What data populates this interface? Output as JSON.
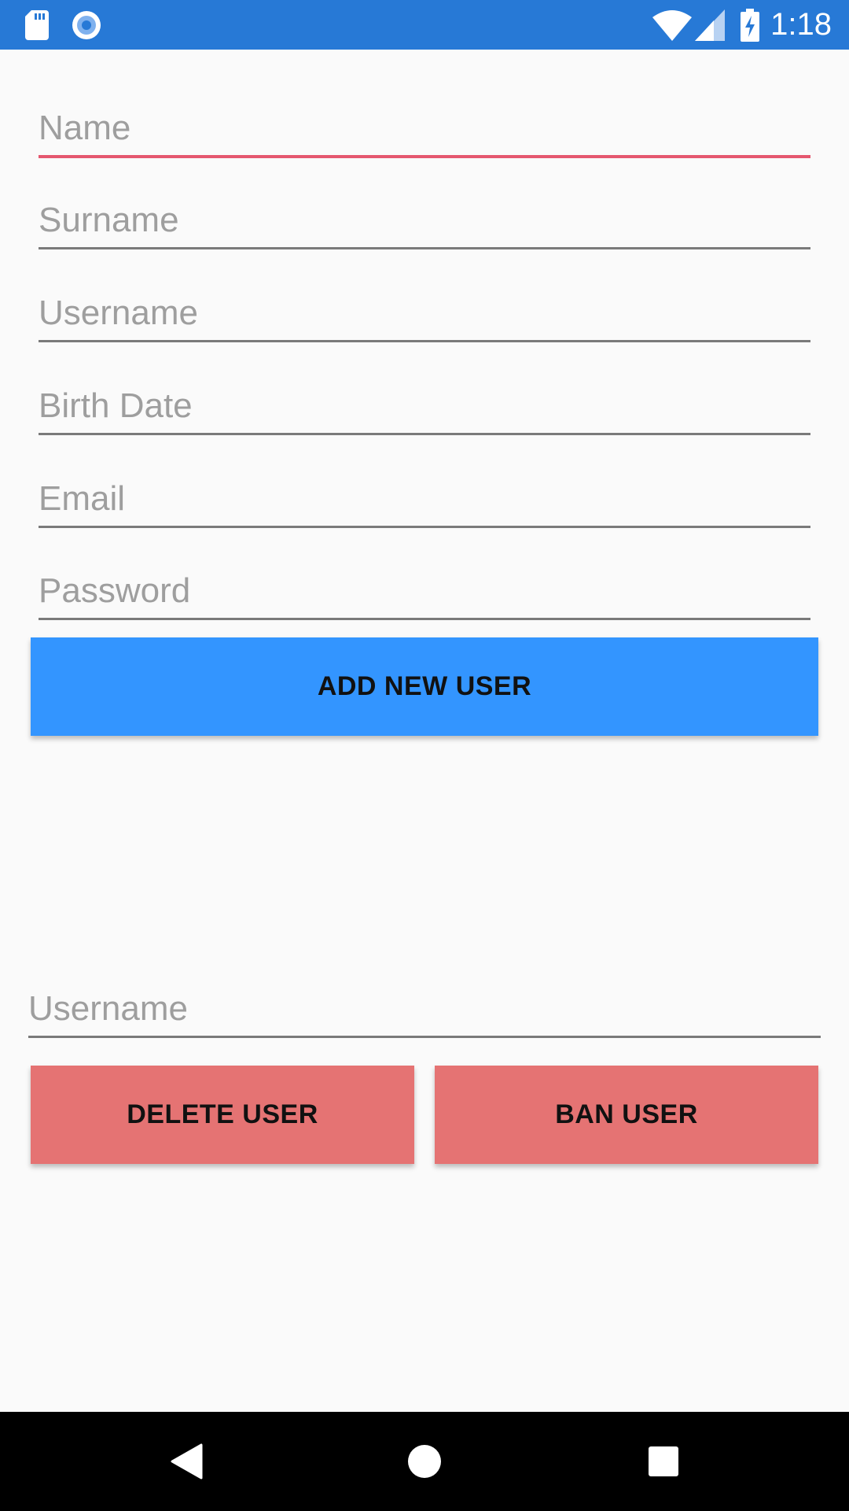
{
  "status_bar": {
    "time": "1:18",
    "icons_left": [
      "sd-card-icon",
      "record-icon"
    ],
    "icons_right": [
      "wifi-icon",
      "signal-icon",
      "battery-charging-icon"
    ],
    "color": "#2779d6"
  },
  "form": {
    "name_placeholder": "Name",
    "surname_placeholder": "Surname",
    "username_placeholder": "Username",
    "birth_date_placeholder": "Birth Date",
    "email_placeholder": "Email",
    "password_placeholder": "Password",
    "add_button_label": "ADD NEW USER",
    "focused_field": "Name",
    "focus_color": "#e5576f",
    "add_button_color": "#3395ff"
  },
  "moderation": {
    "username_placeholder": "Username",
    "delete_button_label": "DELETE USER",
    "ban_button_label": "BAN USER",
    "button_color": "#e57373"
  },
  "nav_bar": {
    "buttons": [
      "back-icon",
      "home-icon",
      "recents-icon"
    ]
  }
}
